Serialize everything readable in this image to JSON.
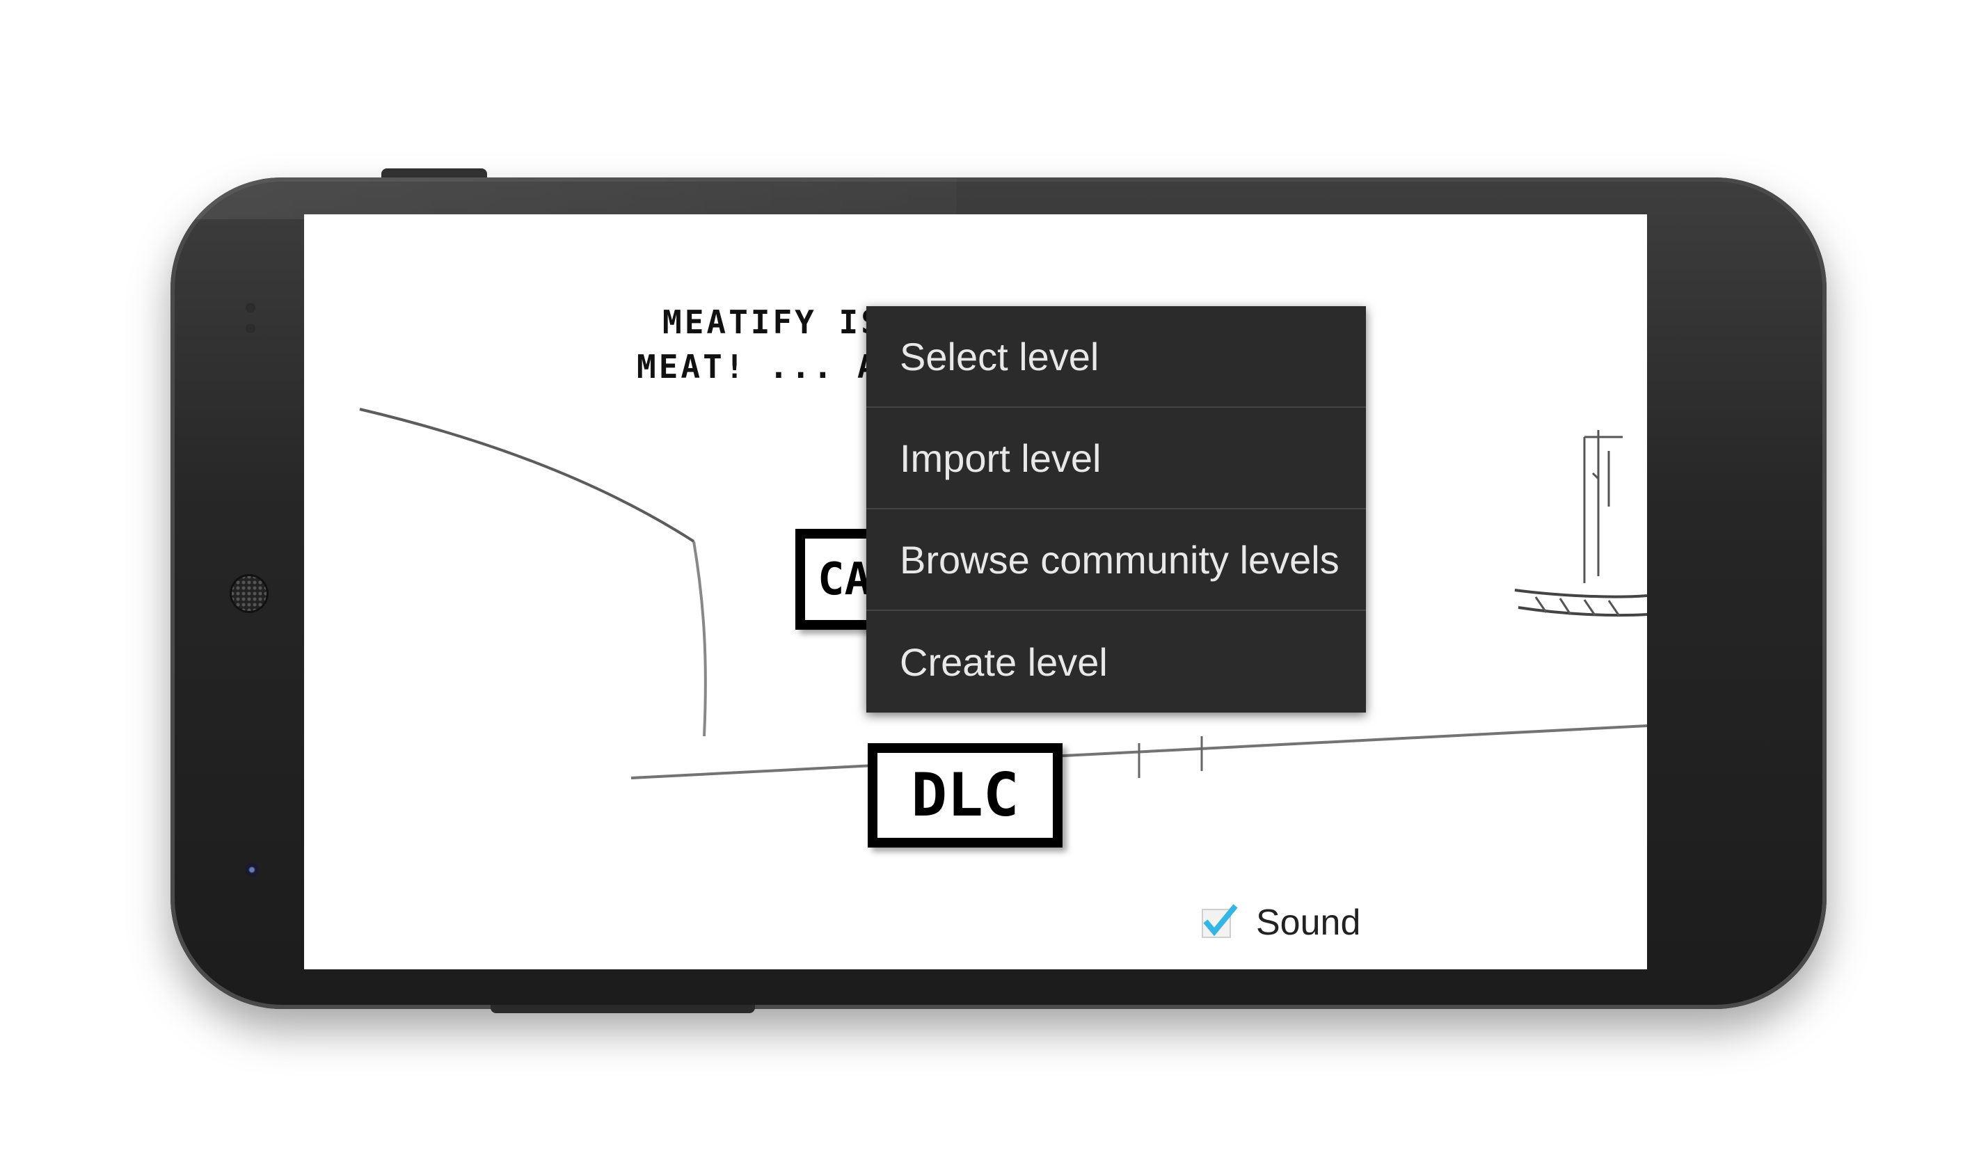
{
  "game": {
    "intro_line1": "MEATIFY IS",
    "intro_line2": "MEAT! ... AN",
    "campaign_button": "CA",
    "dlc_button": "DLC"
  },
  "context_menu": {
    "items": [
      {
        "label": "Select level"
      },
      {
        "label": "Import level"
      },
      {
        "label": "Browse community levels"
      },
      {
        "label": "Create level"
      }
    ]
  },
  "settings": {
    "sound_label": "Sound",
    "sound_checked": true
  },
  "colors": {
    "menu_background": "#2b2b2b",
    "menu_text": "#e8e8e8",
    "checkmark": "#33b5e5",
    "phone_body": "#262626"
  }
}
